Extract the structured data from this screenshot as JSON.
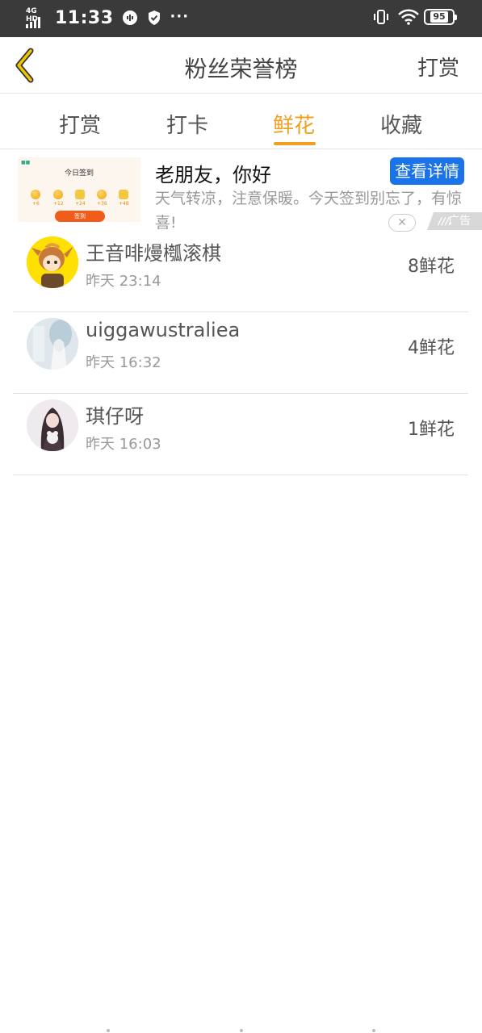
{
  "status_bar": {
    "network": "4G HD",
    "time": "11:33",
    "more": "···",
    "battery": "95"
  },
  "header": {
    "title": "粉丝荣誉榜",
    "right_action": "打赏"
  },
  "tabs": [
    {
      "label": "打赏",
      "active": false
    },
    {
      "label": "打卡",
      "active": false
    },
    {
      "label": "鲜花",
      "active": true
    },
    {
      "label": "收藏",
      "active": false
    }
  ],
  "ad": {
    "thumb_title": "今日签到",
    "thumb_rewards": [
      "+6",
      "+12",
      "+24",
      "+36",
      "+48"
    ],
    "thumb_button": "签到",
    "title": "老朋友，你好",
    "description": "天气转凉，注意保暖。今天签到别忘了，有惊喜!",
    "detail_button": "查看详情",
    "close_icon": "close-icon",
    "badge": "广告"
  },
  "fans": [
    {
      "name": "王音啡熳槬滚棋",
      "time": "昨天 23:14",
      "count": "8鲜花"
    },
    {
      "name": "uiggawustraliea",
      "time": "昨天 16:32",
      "count": "4鲜花"
    },
    {
      "name": "琪仔呀",
      "time": "昨天 16:03",
      "count": "1鲜花"
    }
  ],
  "colors": {
    "accent": "#f0a020",
    "ad_button": "#1a73e8",
    "status_bar": "#3a3a3a"
  }
}
